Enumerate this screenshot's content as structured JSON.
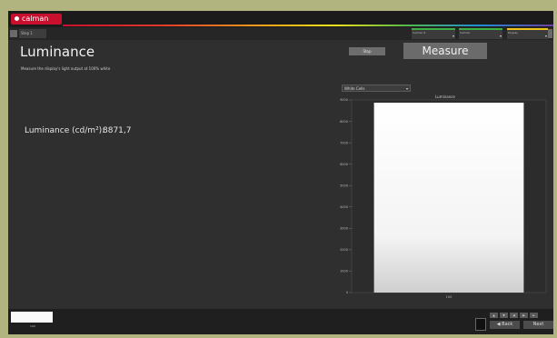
{
  "app": {
    "logo_text": "calman",
    "tab_label": "Step 1"
  },
  "meters": [
    {
      "label": "Calman 9"
    },
    {
      "label": "Calman"
    },
    {
      "label": "Display"
    }
  ],
  "page": {
    "title": "Luminance",
    "subtitle": "Measure the display's light output at 100% white",
    "stop_label": "Stop",
    "measure_label": "Measure",
    "luminance_label": "Luminance (cd/m²):",
    "luminance_value": "8871,7",
    "dropdown_value": "White Cells"
  },
  "chart_data": {
    "type": "bar",
    "title": "Luminance",
    "categories": [
      "100"
    ],
    "values": [
      8871.7
    ],
    "ylim": [
      0,
      9000
    ],
    "yticks": [
      "0",
      "1000",
      "2000",
      "3000",
      "4000",
      "5000",
      "6000",
      "7000",
      "8000",
      "9000"
    ],
    "colors": {
      "plot_bg": "#2c2c2c",
      "bar_top": "#ffffff",
      "bar_bottom": "#cfcfcf"
    }
  },
  "bottom": {
    "swatch_label": "100",
    "back_label": "Back",
    "next_label": "Next"
  }
}
